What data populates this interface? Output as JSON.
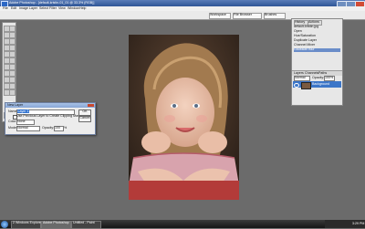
{
  "window": {
    "title": "Adobe Photoshop - [default-kristin-01_01 @ 33.3% (RGB)]"
  },
  "menubar": {
    "items": [
      "File",
      "Edit",
      "Image",
      "Layer",
      "Select",
      "Filter",
      "View",
      "Window",
      "Help"
    ]
  },
  "optionsbar": {
    "buttons": [
      "Workspace",
      "File Browser",
      "Brushes"
    ]
  },
  "palette": {
    "tabs": [
      "History",
      "Actions"
    ],
    "history_items": [
      "default-kristin.jpg",
      "Open",
      "Hue/Saturation",
      "Duplicate Layer",
      "Channel Mixer",
      "Gaussian Blur"
    ],
    "layers_tabs": [
      "Layers",
      "Channels",
      "Paths"
    ],
    "layers_blend": "Normal",
    "layers_opacity_label": "Opacity:",
    "layers_opacity_value": "100%",
    "layers": [
      "Background"
    ]
  },
  "dialog": {
    "title": "New Layer",
    "name_label": "Name:",
    "name_value": "Layer 1",
    "checkbox_label": "Use Previous Layer to Create Clipping Mask",
    "color_label": "Color:",
    "color_value": "None",
    "mode_label": "Mode:",
    "mode_value": "Normal",
    "opacity_label": "Opacity:",
    "opacity_value": "100",
    "opacity_unit": "%",
    "ok": "OK",
    "cancel": "Cancel"
  },
  "taskbar": {
    "tasks": [
      "2 Windows Explorer",
      "Adobe Photoshop",
      "Untitled - Paint"
    ],
    "clock": "3:29 PM"
  }
}
